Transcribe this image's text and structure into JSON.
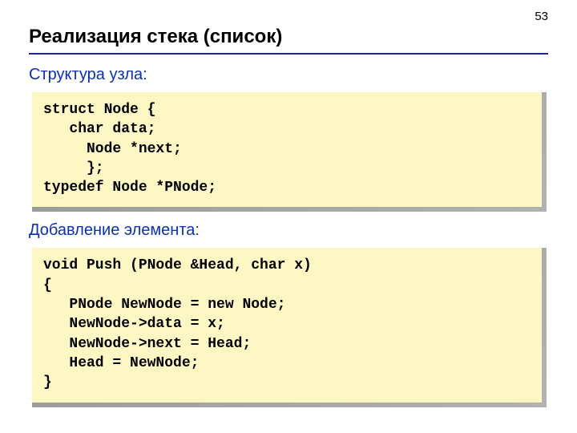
{
  "page_number": "53",
  "title": "Реализация стека (список)",
  "section1": {
    "heading": "Структура узла:",
    "code": "struct Node {\n   char data;\n     Node *next;\n     };\ntypedef Node *PNode;"
  },
  "section2": {
    "heading": "Добавление элемента:",
    "code": "void Push (PNode &Head, char x)\n{\n   PNode NewNode = new Node;\n   NewNode->data = x;\n   NewNode->next = Head;\n   Head = NewNode;\n}"
  }
}
